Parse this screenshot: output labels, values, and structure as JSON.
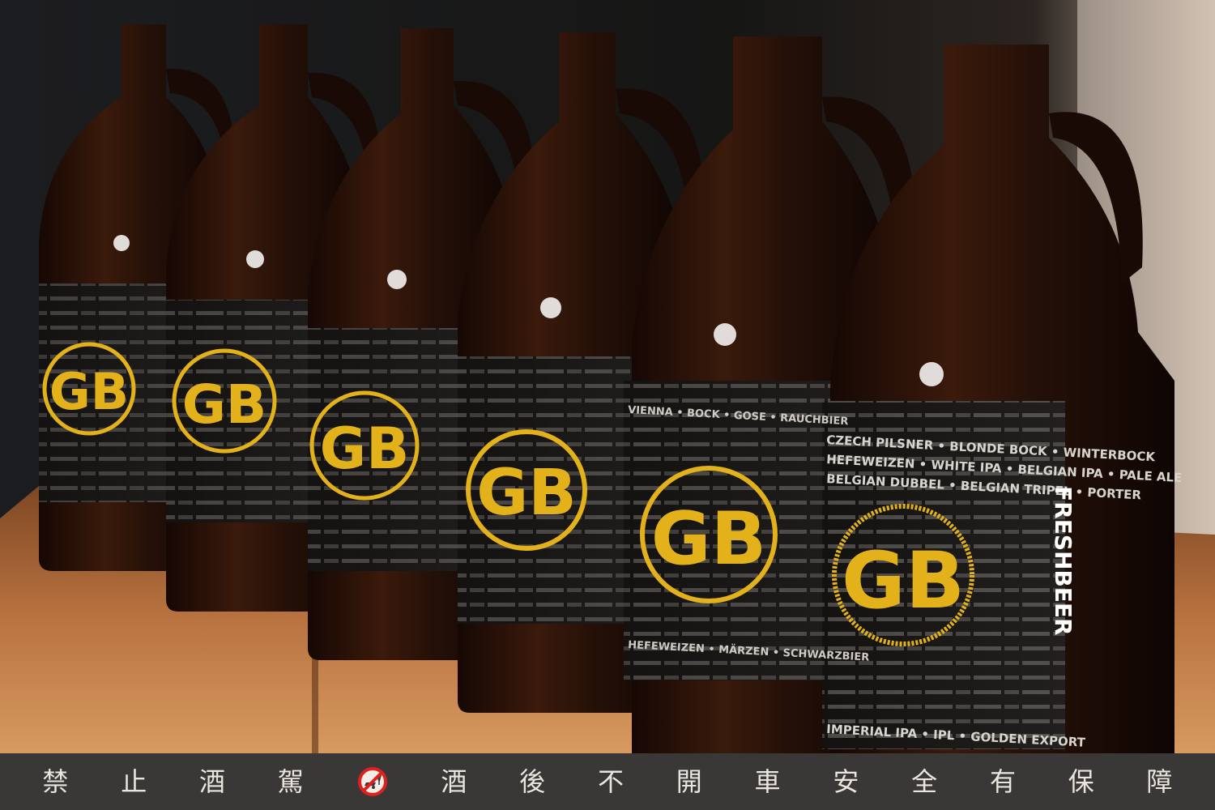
{
  "photo": {
    "logo_text": "GB",
    "labels": [
      {
        "line1": "CZECH PILSNER • BLONDE BOCK • WINTERBOCK",
        "line2": "HEFEWEIZEN • WHITE IPA • BELGIAN IPA • PALE ALE",
        "line3": "BELGIAN DUBBEL • BELGIAN TRIPEL • PORTER"
      },
      {
        "line1": "VIENNA • BOCK • GOSE • RAUCHBIER",
        "line2": "HEFEWEIZEN • MÄRZEN • SCHWARZBIER",
        "line3": "IMPERIAL IPA • IPL • GOLDEN EXPORT"
      }
    ],
    "fresh": "FRESH",
    "beer": "BEER"
  },
  "footer": {
    "chars": [
      "禁",
      "止",
      "酒",
      "駕",
      "酒",
      "後",
      "不",
      "開",
      "車",
      "安",
      "全",
      "有",
      "保",
      "障"
    ],
    "icon": "no-drink-driving-icon"
  },
  "colors": {
    "amber": "#2b1409",
    "gold": "#e3b21a",
    "wood": "#b8723f"
  }
}
